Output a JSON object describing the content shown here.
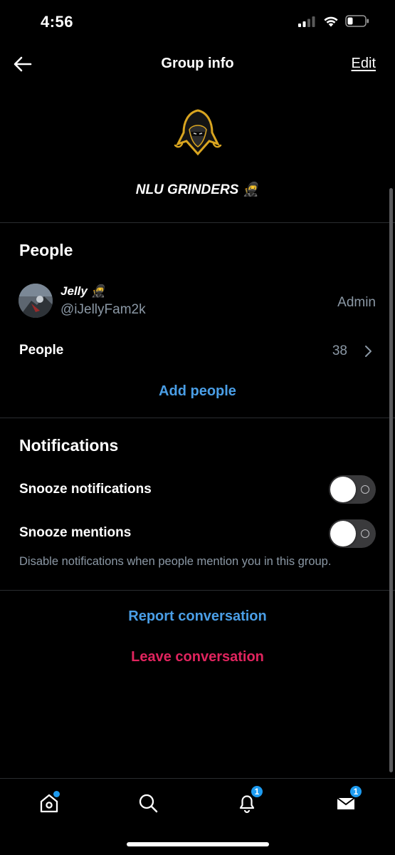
{
  "status": {
    "time": "4:56",
    "signal_icon": "cellular-signal-icon",
    "wifi_icon": "wifi-icon",
    "battery_icon": "battery-low-icon"
  },
  "nav": {
    "title": "Group info",
    "edit_label": "Edit",
    "back_icon": "arrow-left-icon"
  },
  "group": {
    "name": "NLU GRINDERS 🥷",
    "avatar_icon": "hooded-ninja-logo"
  },
  "people": {
    "title": "People",
    "admin": {
      "name": "Jelly 🥷",
      "handle": "@iJellyFam2k",
      "role": "Admin"
    },
    "people_label": "People",
    "people_count": "38",
    "add_people_label": "Add people"
  },
  "notifications": {
    "title": "Notifications",
    "snooze_notifications_label": "Snooze notifications",
    "snooze_mentions_label": "Snooze mentions",
    "hint": "Disable notifications when people mention you in this group.",
    "snooze_notifications_on": false,
    "snooze_mentions_on": false
  },
  "actions": {
    "report_label": "Report conversation",
    "leave_label": "Leave conversation"
  },
  "tabs": {
    "home_icon": "home-icon",
    "search_icon": "search-icon",
    "notifications_icon": "bell-icon",
    "notifications_badge": "1",
    "messages_icon": "mail-icon",
    "messages_badge": "1"
  },
  "colors": {
    "background": "#000000",
    "link_blue": "#4a9ee6",
    "danger_red": "#e0245e",
    "muted": "#8b98a5",
    "badge_blue": "#1d9bf0"
  }
}
